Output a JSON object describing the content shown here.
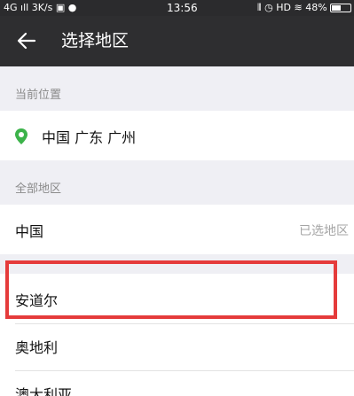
{
  "status_bar": {
    "network": "4G",
    "speed": "3K/s",
    "time": "13:56",
    "hd": "HD",
    "battery": "48%",
    "battery_level": 0.48
  },
  "app_bar": {
    "back_icon": "arrow-left-icon",
    "title": "选择地区"
  },
  "current_location": {
    "header": "当前位置",
    "pin_icon": "location-pin-icon",
    "pin_color": "#3cb34a",
    "value": "中国 广东 广州"
  },
  "all_regions": {
    "header": "全部地区",
    "items": [
      {
        "label": "中国",
        "tag": "已选地区"
      },
      {
        "label": "安道尔"
      },
      {
        "label": "奥地利"
      },
      {
        "label": "澳大利亚"
      }
    ]
  },
  "annotation": {
    "highlight_color": "#e53b3b"
  }
}
